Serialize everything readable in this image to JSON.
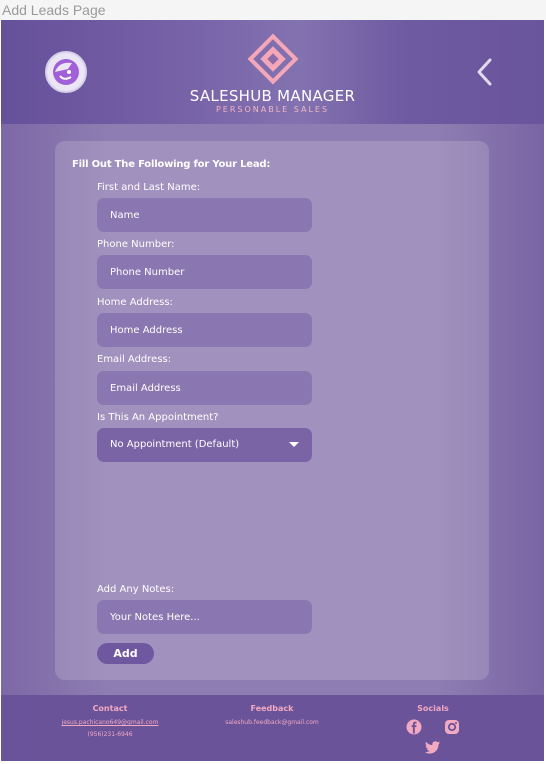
{
  "window": {
    "title": "Add Leads Page"
  },
  "header": {
    "brand_title": "SALESHUB MANAGER",
    "brand_subtitle": "PERSONABLE SALES",
    "avatar_icon": "avatar-face-icon",
    "back_icon": "chevron-left-icon"
  },
  "form": {
    "heading": "Fill Out The Following for Your Lead:",
    "name": {
      "label": "First and Last Name:",
      "placeholder": "Name"
    },
    "phone": {
      "label": "Phone Number:",
      "placeholder": "Phone Number"
    },
    "address": {
      "label": "Home Address:",
      "placeholder": "Home Address"
    },
    "email": {
      "label": "Email Address:",
      "placeholder": "Email Address"
    },
    "appointment": {
      "label": "Is This An Appointment?",
      "selected": "No Appointment (Default)"
    },
    "notes": {
      "label": "Add Any Notes:",
      "placeholder": "Your Notes Here..."
    },
    "submit_label": "Add"
  },
  "footer": {
    "contact": {
      "heading": "Contact",
      "email": "jesus.pachicano649@gmail.com",
      "phone": "(956)231-6946"
    },
    "feedback": {
      "heading": "Feedback",
      "email": "saleshub.feedback@gmail.com"
    },
    "socials": {
      "heading": "Socials",
      "icons": [
        "facebook-icon",
        "instagram-icon",
        "twitter-icon"
      ]
    }
  },
  "colors": {
    "brand_pink": "#f2a9c2",
    "header_purple": "#65509a",
    "footer_purple": "#6a5399",
    "input_purple": "#8a76b0"
  }
}
